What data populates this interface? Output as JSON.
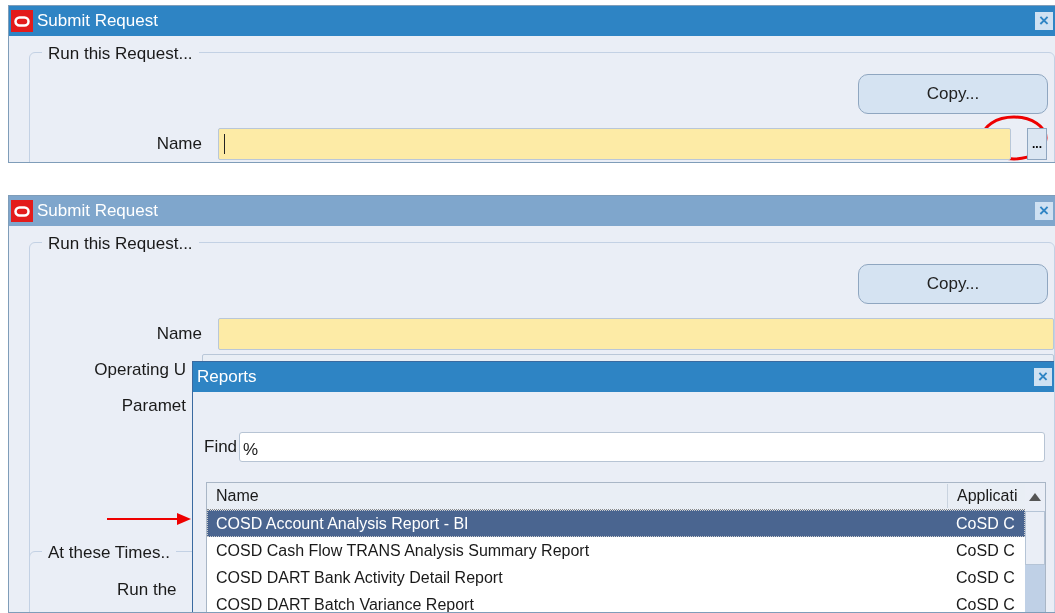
{
  "screens": [
    {
      "window": {
        "title": "Submit Request",
        "active": true,
        "close": "×"
      },
      "group_title": "Run this Request...",
      "copy_button": "Copy...",
      "fields": [
        {
          "label": "Name",
          "kind": "lov",
          "focused": true,
          "button": "..."
        }
      ]
    },
    {
      "window": {
        "title": "Submit Request",
        "active": false,
        "close": "×"
      },
      "group_title": "Run this Request...",
      "copy_button": "Copy...",
      "fields": [
        {
          "label": "Name",
          "kind": "text",
          "focused": false
        },
        {
          "label": "Operating U",
          "kind": "text"
        },
        {
          "label": "Paramet",
          "kind": "label"
        }
      ],
      "group2_title": "At these Times..",
      "group2_label": "Run the",
      "dialog": {
        "title": "Reports",
        "close": "×",
        "find_label": "Find",
        "find_value": "%",
        "columns": [
          "Name",
          "Applicati"
        ],
        "rows": [
          {
            "name": "COSD Account Analysis Report - BI",
            "application": "CoSD C",
            "selected": true
          },
          {
            "name": "COSD Cash Flow TRANS Analysis Summary Report",
            "application": "CoSD C",
            "selected": false
          },
          {
            "name": "COSD DART Bank Activity Detail Report",
            "application": "CoSD C",
            "selected": false
          },
          {
            "name": "COSD DART Batch Variance Report",
            "application": "CoSD C",
            "selected": false
          }
        ]
      }
    }
  ]
}
